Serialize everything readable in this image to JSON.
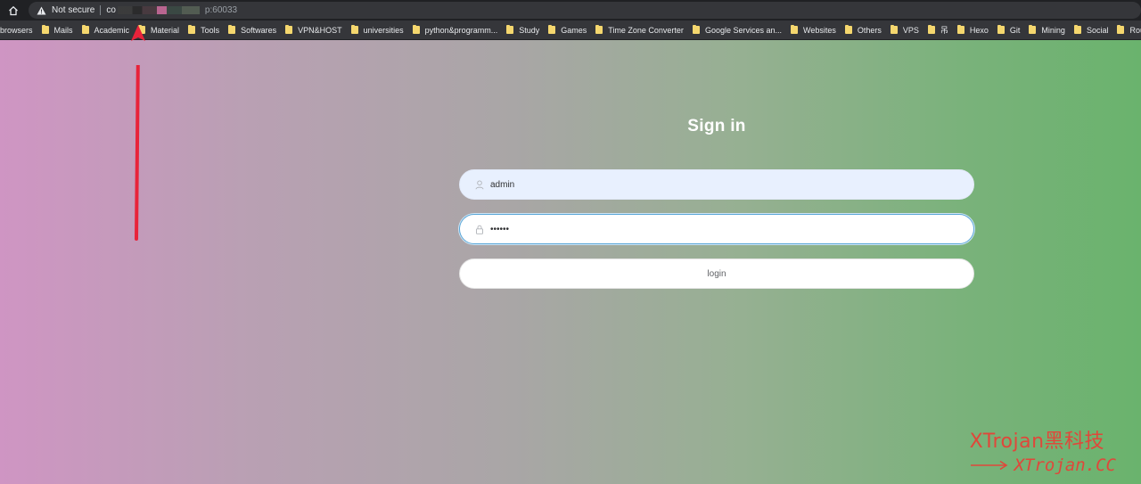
{
  "browser": {
    "security_label": "Not secure",
    "url_host": "co",
    "url_port": "p:60033"
  },
  "bookmarks": [
    {
      "label": "browsers"
    },
    {
      "label": "Mails"
    },
    {
      "label": "Academic"
    },
    {
      "label": "Material"
    },
    {
      "label": "Tools"
    },
    {
      "label": "Softwares"
    },
    {
      "label": "VPN&HOST"
    },
    {
      "label": "universities"
    },
    {
      "label": "python&programm..."
    },
    {
      "label": "Study"
    },
    {
      "label": "Games"
    },
    {
      "label": "Time Zone Converter"
    },
    {
      "label": "Google Services an..."
    },
    {
      "label": "Websites"
    },
    {
      "label": "Others"
    },
    {
      "label": "VPS"
    },
    {
      "label": "吊"
    },
    {
      "label": "Hexo"
    },
    {
      "label": "Git"
    },
    {
      "label": "Mining"
    },
    {
      "label": "Social"
    },
    {
      "label": "Route"
    }
  ],
  "login": {
    "title": "Sign in",
    "username_value": "admin",
    "password_value": "••••••",
    "button_label": "login"
  },
  "watermark": {
    "line1": "XTrojan黑科技",
    "line2": "XTrojan.CC"
  },
  "colors": {
    "annotation_red": "#e8233a",
    "watermark_red": "#e0473a"
  }
}
